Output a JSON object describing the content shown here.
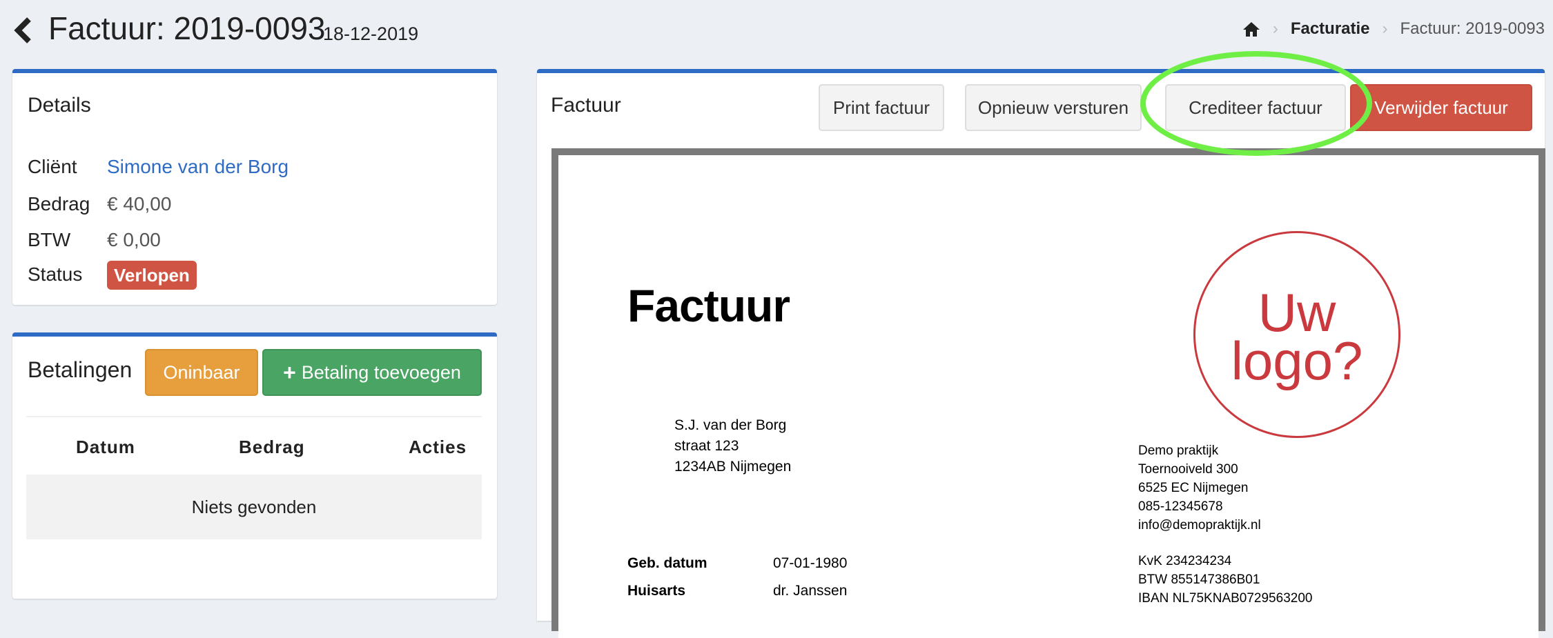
{
  "header": {
    "title": "Factuur: 2019-0093",
    "date": "18-12-2019"
  },
  "breadcrumb": {
    "items": [
      "Facturatie",
      "Factuur: 2019-0093"
    ]
  },
  "details": {
    "title": "Details",
    "rows": [
      {
        "label": "Cliënt",
        "value": "Simone van der Borg"
      },
      {
        "label": "Bedrag",
        "value": "€ 40,00"
      },
      {
        "label": "BTW",
        "value": "€ 0,00"
      },
      {
        "label": "Status",
        "value": "Verlopen"
      }
    ]
  },
  "payments": {
    "title": "Betalingen",
    "uncollectible_label": "Oninbaar",
    "add_label": "Betaling toevoegen",
    "columns": [
      "Datum",
      "Bedrag",
      "Acties"
    ],
    "empty": "Niets gevonden"
  },
  "invoice": {
    "title": "Factuur",
    "print_label": "Print factuur",
    "resend_label": "Opnieuw versturen",
    "credit_label": "Crediteer factuur",
    "delete_label": "Verwijder factuur"
  },
  "document": {
    "title": "Factuur",
    "logo": [
      "Uw",
      "logo?"
    ],
    "recipient": [
      "S.J. van der Borg",
      "straat 123",
      "1234AB Nijmegen"
    ],
    "company": [
      "Demo praktijk",
      "Toernooiveld 300",
      "6525 EC Nijmegen",
      "085-12345678",
      "info@demopraktijk.nl"
    ],
    "registration": [
      "KvK 234234234",
      "BTW 855147386B01",
      "IBAN NL75KNAB0729563200"
    ],
    "fields": [
      {
        "label": "Geb. datum",
        "value": "07-01-1980"
      },
      {
        "label": "Huisarts",
        "value": "dr. Janssen"
      }
    ]
  },
  "colors": {
    "accent": "#2d6bc4",
    "danger": "#d05443",
    "warning": "#e69f3c",
    "success": "#4aa463",
    "highlight": "#6fef46"
  }
}
